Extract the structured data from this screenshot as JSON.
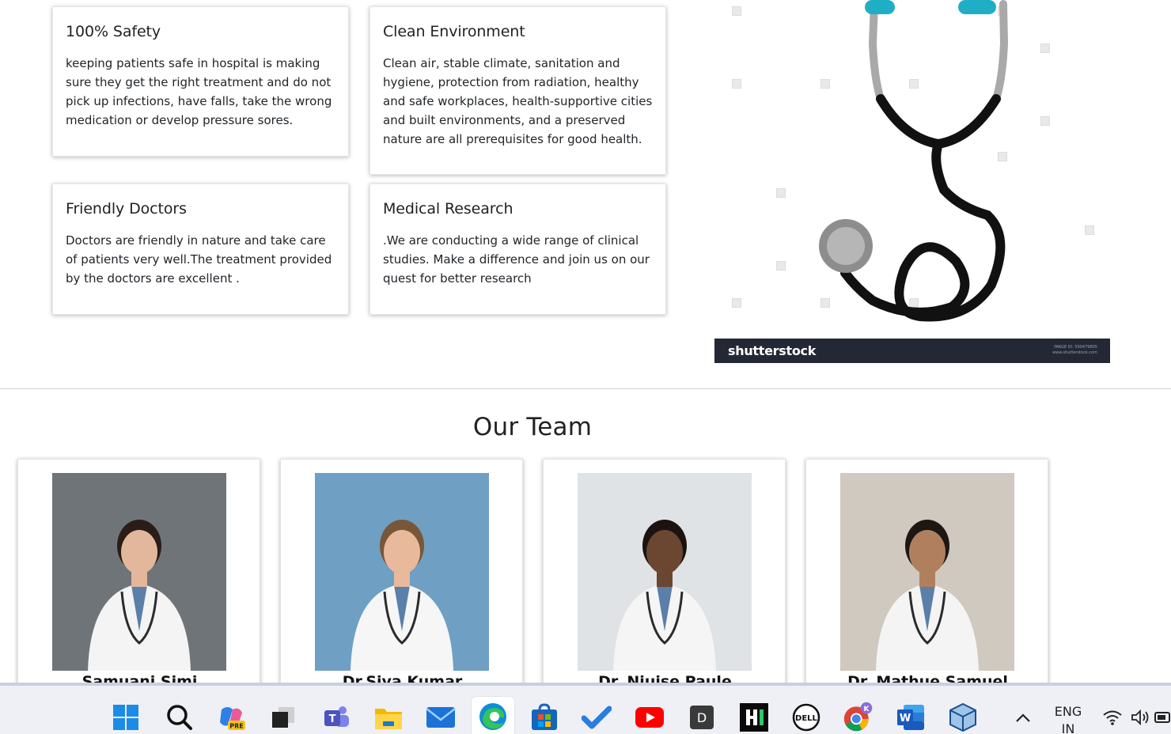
{
  "features": [
    {
      "title": "100% Safety",
      "text": "keeping patients safe in hospital is making sure they get the right treatment and do not pick up infections, have falls, take the wrong medication or develop pressure sores."
    },
    {
      "title": "Clean Environment",
      "text": "Clean air, stable climate, sanitation and hygiene, protection from radiation, healthy and safe workplaces, health-supportive cities and built environments, and a preserved nature are all prerequisites for good health."
    },
    {
      "title": "Friendly Doctors",
      "text": "Doctors are friendly in nature and take care of patients very well.The treatment provided by the doctors are excellent ."
    },
    {
      "title": "Medical Research",
      "text": ".We are conducting a wide range of clinical studies. Make a difference and join us on our quest for better research"
    }
  ],
  "hero": {
    "brand": "shutterstock",
    "meta_line1": "IMAGE ID: 590479805",
    "meta_line2": "www.shutterstock.com"
  },
  "team": {
    "title": "Our Team",
    "members": [
      {
        "name": "Samuani Simi",
        "bg": "#6f7478",
        "coat": "#f4f4f4",
        "skin": "#e2b79c",
        "hair": "#2a1d18"
      },
      {
        "name": "Dr.Siva Kumar",
        "bg": "#6f9fc3",
        "coat": "#f6f6f6",
        "skin": "#e8b99a",
        "hair": "#7a5638"
      },
      {
        "name": "Dr. Niuise Paule",
        "bg": "#dfe3e6",
        "coat": "#f5f5f5",
        "skin": "#6b4630",
        "hair": "#1c1310"
      },
      {
        "name": "Dr. Mathue Samuel",
        "bg": "#cfc9c0",
        "coat": "#f4f4f4",
        "skin": "#b0805e",
        "hair": "#1d1612"
      }
    ]
  },
  "taskbar": {
    "icons": [
      "windows-start-icon",
      "search-icon",
      "copilot-icon",
      "task-view-icon",
      "teams-icon",
      "file-explorer-icon",
      "mail-icon",
      "edge-icon",
      "store-icon",
      "todo-icon",
      "youtube-icon",
      "d-app-icon",
      "hackerrank-icon",
      "dell-icon",
      "chrome-icon",
      "word-icon",
      "box-app-icon"
    ],
    "lang_line1": "ENG",
    "lang_line2": "IN",
    "copilot_badge": "PRE",
    "teams_letter": "T",
    "d_letter": "D",
    "dell_text": "DELL",
    "chrome_badge": "K",
    "word_letter": "W"
  }
}
